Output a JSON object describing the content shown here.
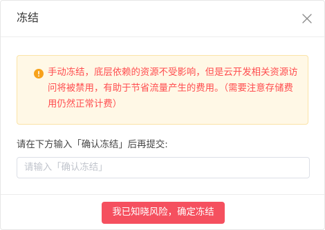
{
  "dialog": {
    "title": "冻结",
    "close_icon": "close-icon"
  },
  "alert": {
    "icon": "warning-circle-icon",
    "message": "手动冻结，底层依赖的资源不受影响，但是云开发相关资源访问将被禁用，有助于节省流量产生的费用。（需要注意存储费用仍然正常计费）",
    "color": "#ff4d4f",
    "background": "#fff8e6"
  },
  "form": {
    "prompt": "请在下方输入「确认冻结」后再提交:",
    "input_value": "",
    "input_placeholder": "请输入「确认冻结」"
  },
  "footer": {
    "confirm_label": "我已知晓风险，确定冻结",
    "confirm_color": "#f5505f"
  }
}
